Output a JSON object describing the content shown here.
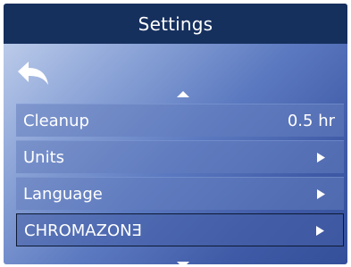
{
  "header": {
    "title": "Settings"
  },
  "navigation": {
    "back_icon": "back-arrow-icon",
    "scroll_up_icon": "caret-up-icon",
    "scroll_down_icon": "caret-down-icon"
  },
  "menu": {
    "items": [
      {
        "label": "Cleanup",
        "value": "0.5 hr"
      },
      {
        "label": "Units",
        "icon": "chevron-right-icon"
      },
      {
        "label": "Language",
        "icon": "chevron-right-icon"
      },
      {
        "label": "CHROMAZONƎ",
        "icon": "chevron-right-icon",
        "selected": true
      }
    ]
  },
  "colors": {
    "title_bar": "#16305e",
    "text": "#ffffff",
    "selected_border": "#0d1a33"
  }
}
